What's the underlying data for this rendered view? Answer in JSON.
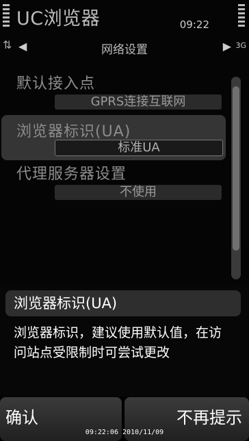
{
  "status": {
    "app_title": "UC浏览器",
    "clock": "09:22"
  },
  "nav": {
    "sync_icon": "⇅",
    "left_arrow": "◀",
    "page_label": "网络设置",
    "right_arrow": "▶",
    "mode_label": "3G"
  },
  "settings": [
    {
      "label": "默认接入点",
      "value": "GPRS连接互联网"
    },
    {
      "label": "浏览器标识(UA)",
      "value": "标准UA"
    },
    {
      "label": "代理服务器设置",
      "value": "不使用"
    }
  ],
  "popup": {
    "title": "浏览器标识(UA)",
    "body": "浏览器标识，建议使用默认值，在访问站点受限制时可尝试更改"
  },
  "softkeys": {
    "left": "确认",
    "right": "不再提示"
  },
  "timestamp": "09:22:06 2010/11/09"
}
